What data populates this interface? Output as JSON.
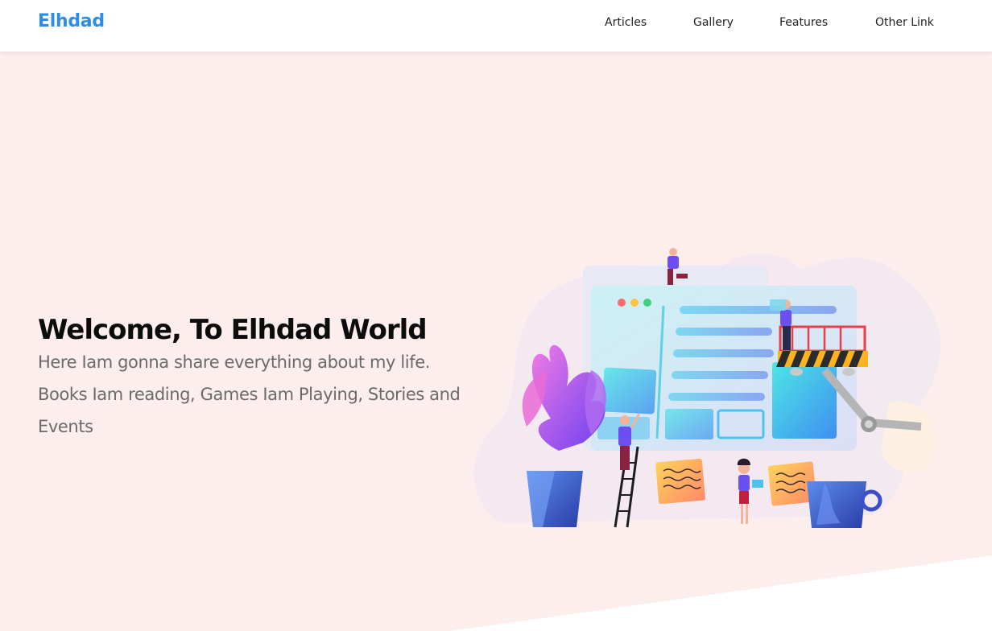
{
  "brand": {
    "name": "Elhdad",
    "color": "#2d8ee8"
  },
  "nav": {
    "items": [
      {
        "label": "Articles"
      },
      {
        "label": "Gallery"
      },
      {
        "label": "Features"
      },
      {
        "label": "Other Link"
      }
    ]
  },
  "hero": {
    "title": "Welcome, To Elhdad World",
    "subtitle": "Here Iam gonna share everything about my life. Books Iam reading, Games Iam Playing, Stories and Events"
  },
  "colors": {
    "page_background": "#fdeeee",
    "navbar_background": "#ffffff",
    "title_text": "#0c0c0c",
    "subtitle_text": "#6a6a6a"
  }
}
